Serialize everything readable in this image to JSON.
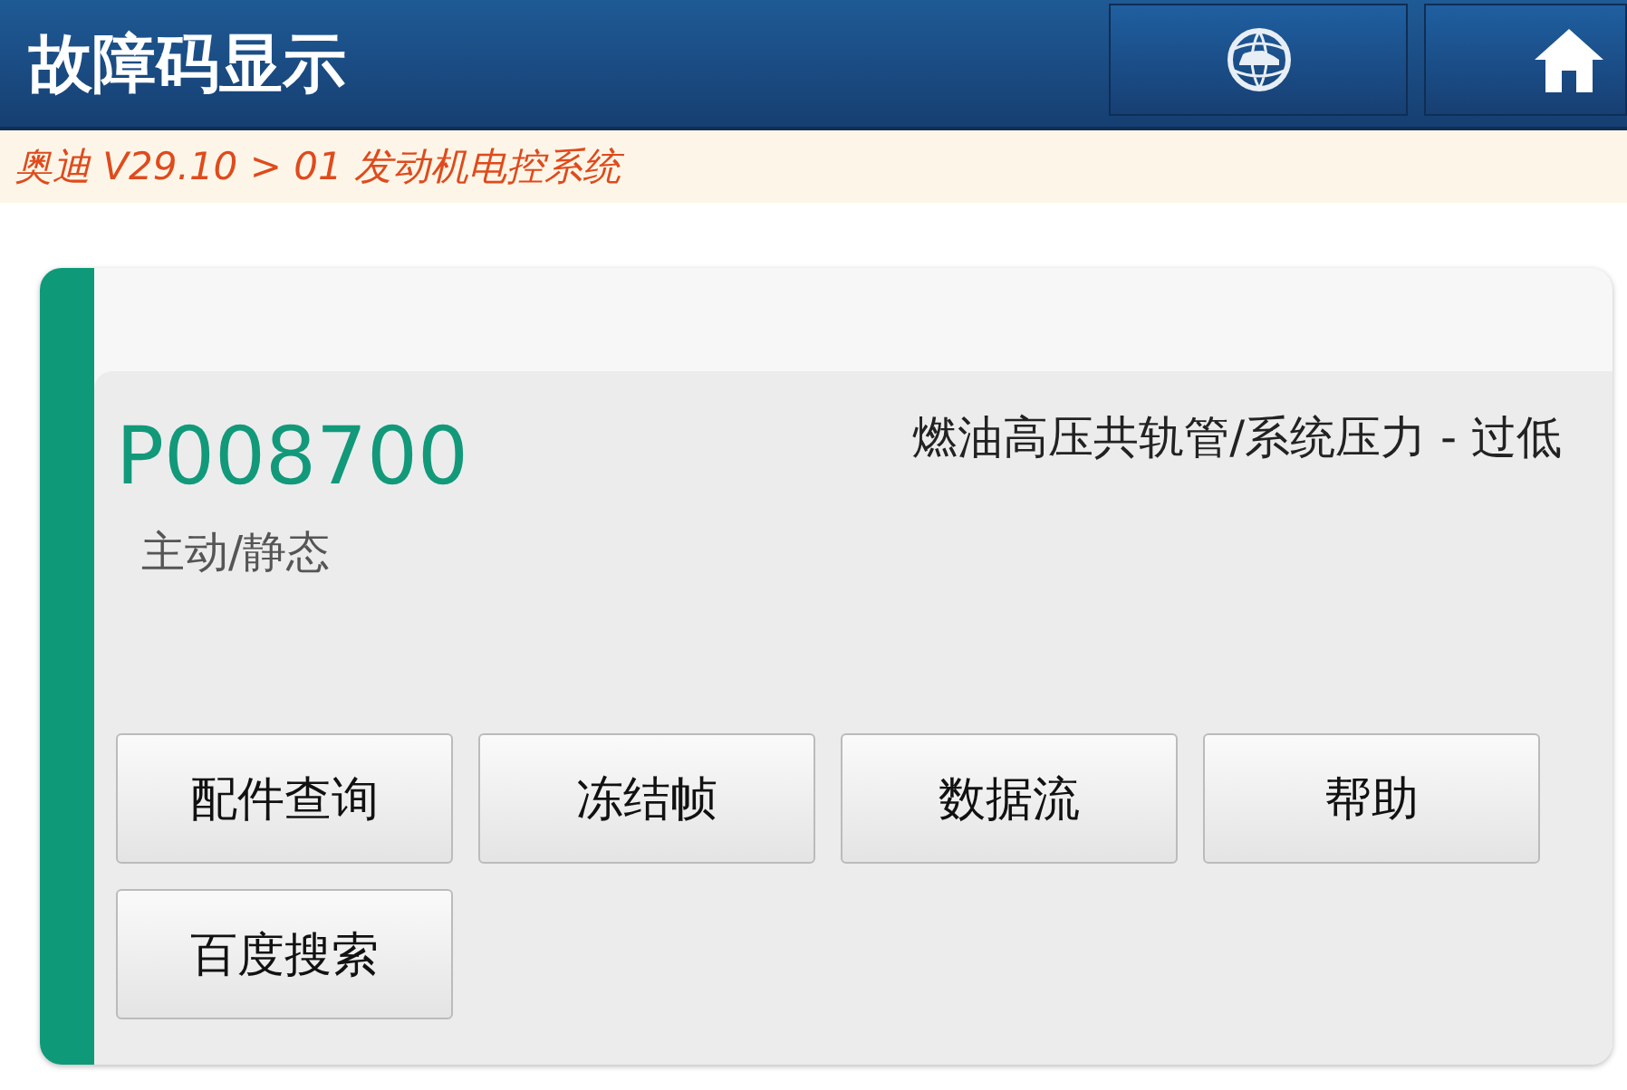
{
  "header": {
    "title": "故障码显示"
  },
  "breadcrumb": "奥迪 V29.10 > 01 发动机电控系统",
  "fault": {
    "code": "P008700",
    "status": "主动/静态",
    "description": "燃油高压共轨管/系统压力 - 过低"
  },
  "buttons": [
    "配件查询",
    "冻结帧",
    "数据流",
    "帮助",
    "百度搜索"
  ]
}
